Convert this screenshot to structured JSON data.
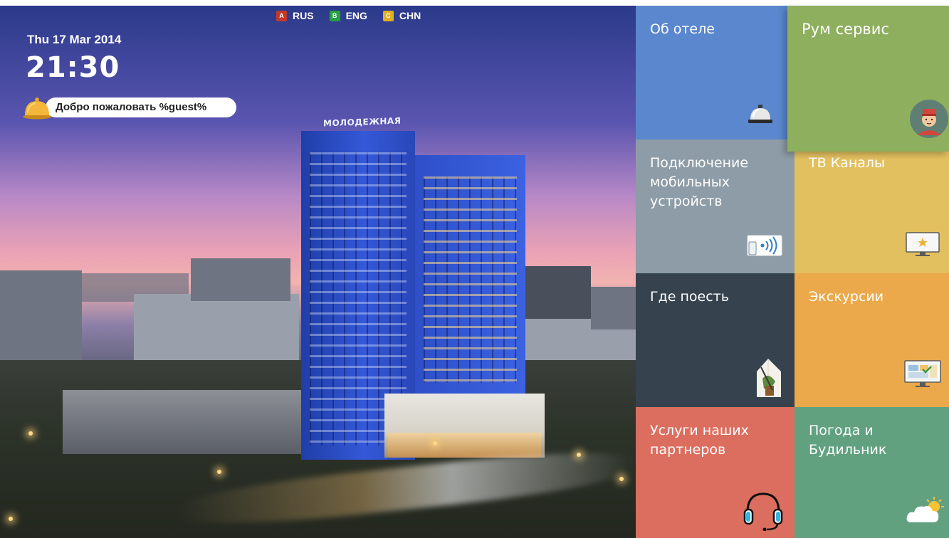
{
  "languages": [
    {
      "key": "A",
      "label": "RUS",
      "color": "#c0392b"
    },
    {
      "key": "B",
      "label": "ENG",
      "color": "#27a043"
    },
    {
      "key": "C",
      "label": "CHN",
      "color": "#e0b020"
    }
  ],
  "header": {
    "date": "Thu 17 Mar 2014",
    "time": "21:30",
    "welcome": "Добро пожаловать %guest%",
    "hotel_sign": "МОЛОДЕЖНАЯ"
  },
  "tiles": {
    "about": {
      "label": "Об отеле",
      "icon": "reception-bell-icon",
      "color": "#5a87cd"
    },
    "room": {
      "label": "Рум сервис",
      "icon": "bellboy-avatar-icon",
      "color": "#8daf5e"
    },
    "mobile": {
      "label": "Подключение\nмобильных\nустройств",
      "icon": "mobile-cast-icon",
      "color": "#8d9ca6"
    },
    "tv": {
      "label": "ТВ Каналы",
      "icon": "tv-star-icon",
      "color": "#e3c05f"
    },
    "eat": {
      "label": "Где поесть",
      "icon": "dish-icon",
      "color": "#36434e"
    },
    "excur": {
      "label": "Экскурсии",
      "icon": "monitor-map-icon",
      "color": "#eba94b"
    },
    "partner": {
      "label": "Услуги наших\nпартнеров",
      "icon": "headset-icon",
      "color": "#dc6e5f"
    },
    "weather": {
      "label": "Погода и\nБудильник",
      "icon": "cloud-sun-icon",
      "color": "#61a180"
    }
  }
}
